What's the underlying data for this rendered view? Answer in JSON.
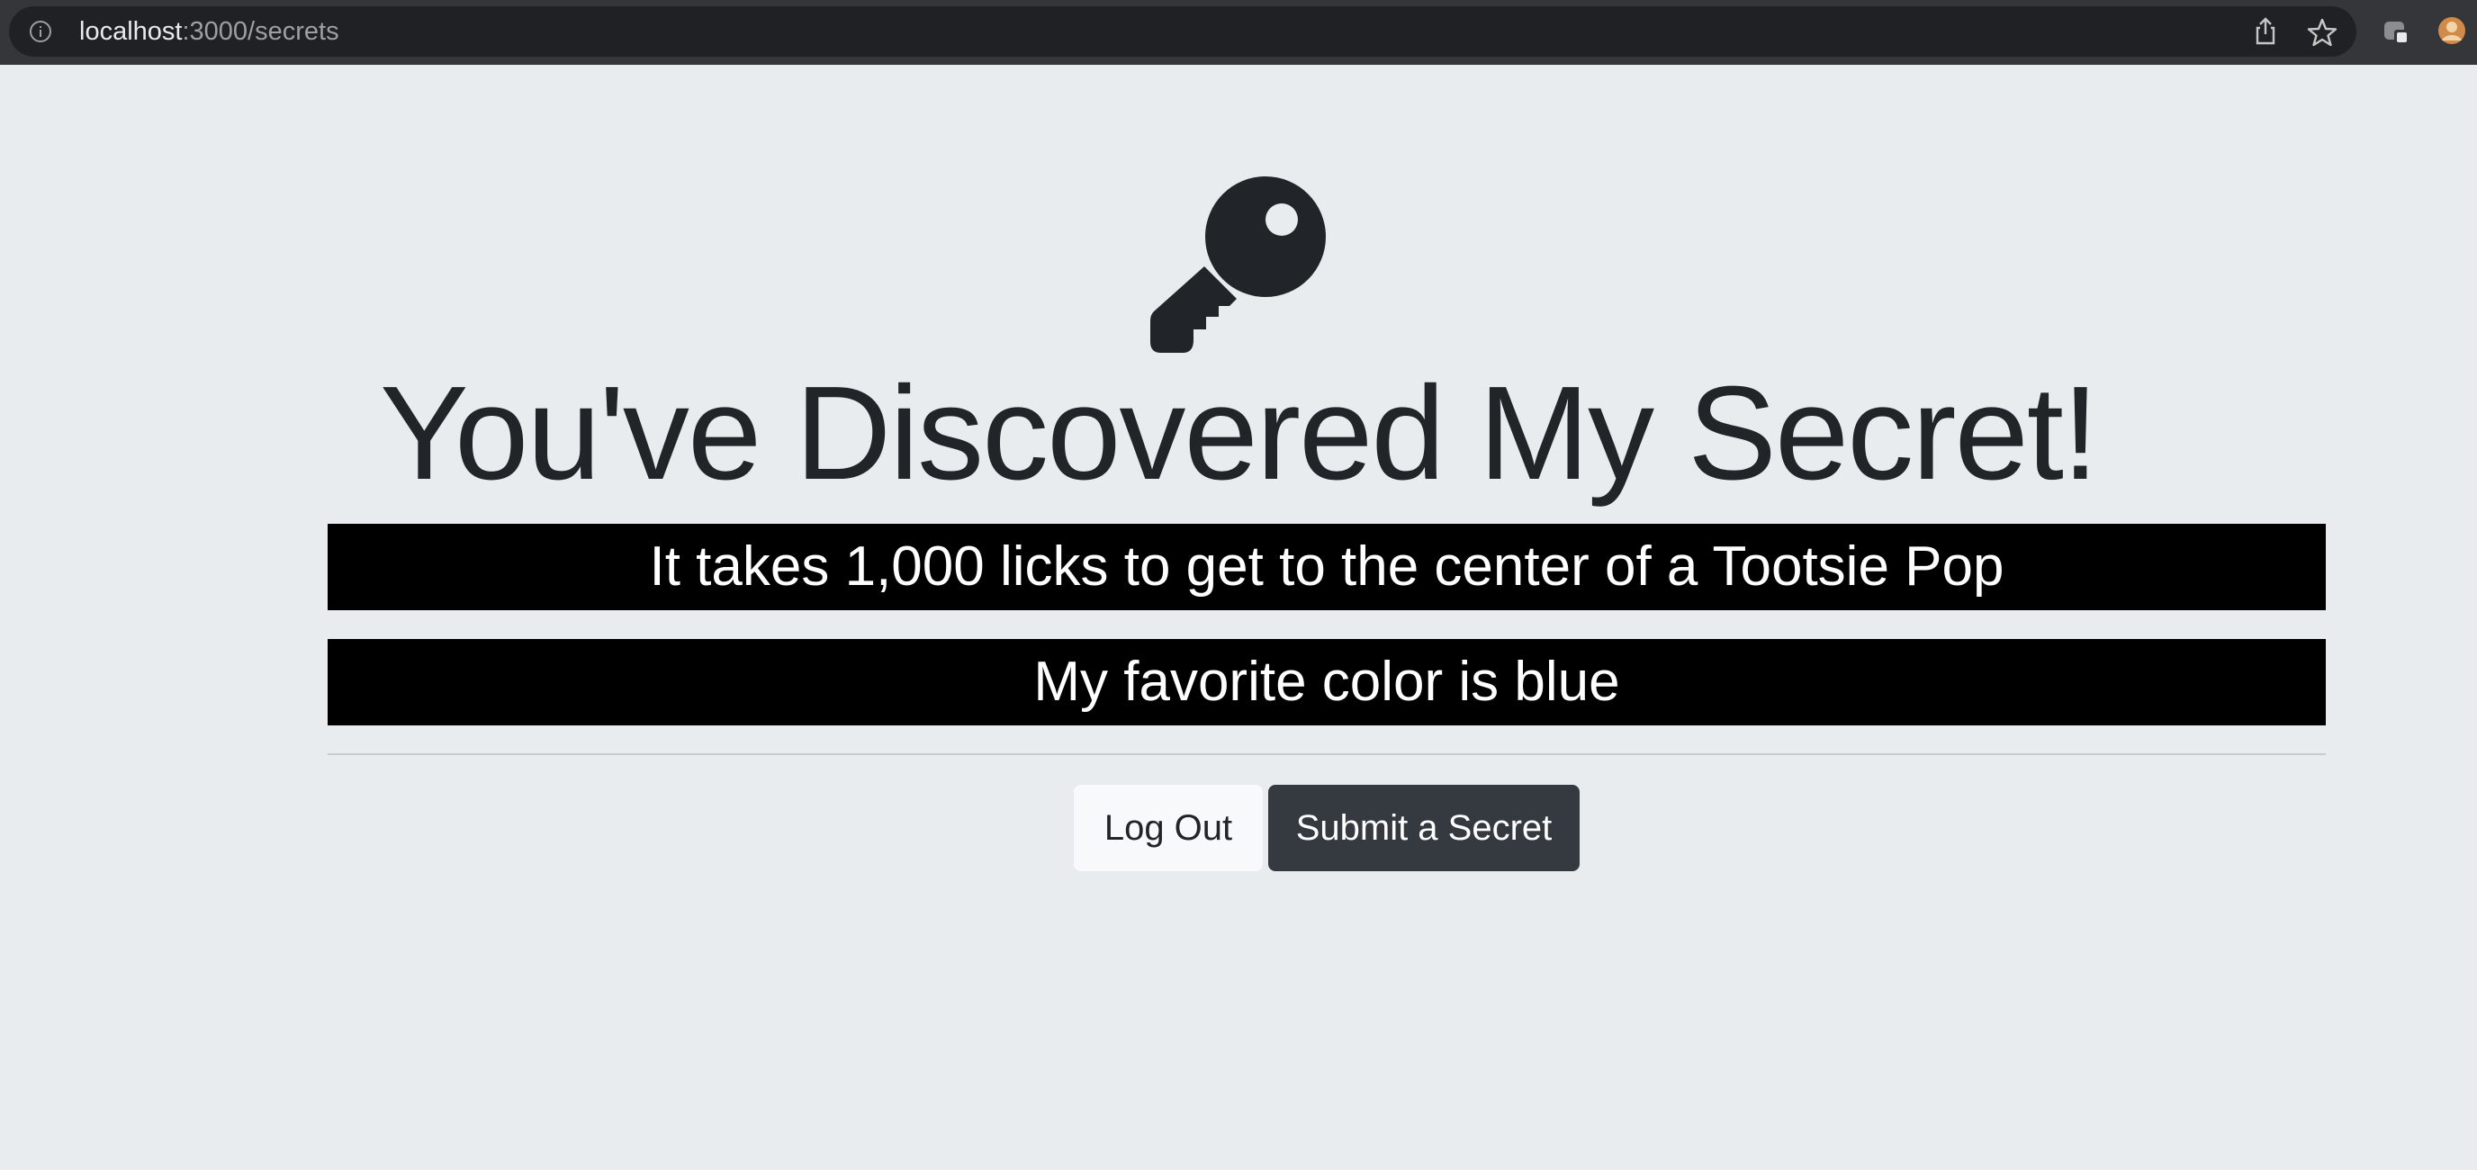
{
  "browser": {
    "url_host": "localhost",
    "url_path": ":3000/secrets",
    "icons": [
      "info-icon",
      "share-icon",
      "star-icon",
      "extension-icon",
      "profile-avatar-icon"
    ]
  },
  "page": {
    "icon": "key-icon",
    "title": "You've Discovered My Secret!",
    "secrets": [
      "It takes 1,000 licks to get to the center of a Tootsie Pop",
      "My favorite color is blue"
    ],
    "buttons": {
      "logout_label": "Log Out",
      "submit_label": "Submit a Secret"
    }
  },
  "colors": {
    "background": "#e8ecef",
    "secret_bg": "#000000",
    "text_dark": "#212529",
    "button_dark": "#343a40",
    "button_light": "#f8f9fa"
  }
}
